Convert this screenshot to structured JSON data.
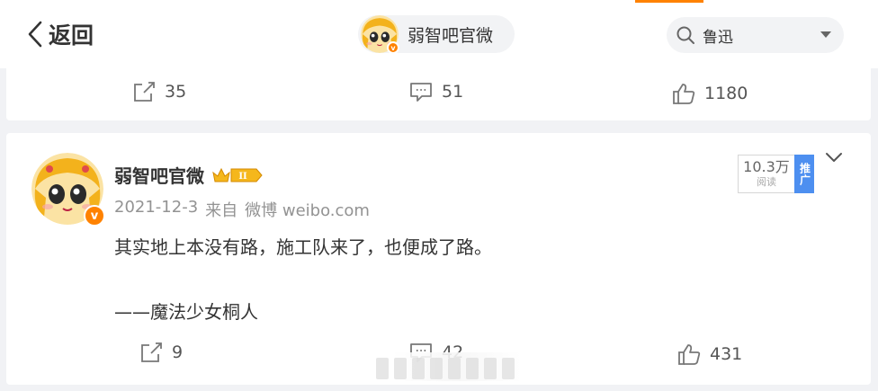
{
  "header": {
    "back_label": "返回",
    "user_name": "弱智吧官微",
    "search_value": "鲁迅"
  },
  "prev_post": {
    "reposts": "35",
    "comments": "51",
    "likes": "1180"
  },
  "post": {
    "author": "弱智吧官微",
    "level_badge": "II",
    "date": "2021-12-3",
    "source_prefix": "来自",
    "source": "微博 weibo.com",
    "text_line1": "其实地上本没有路，施工队来了，也便成了路。",
    "text_line2": "——魔法少女桐人",
    "reads_count": "10.3万",
    "reads_label": "阅读",
    "promo_label": "推广",
    "reposts": "9",
    "comments": "42",
    "likes": "431"
  },
  "colors": {
    "accent": "#ff8200",
    "promo": "#4d8ff0"
  },
  "icons": [
    "back-chevron-icon",
    "search-icon",
    "dropdown-arrow-icon",
    "repost-icon",
    "comment-icon",
    "like-icon",
    "vip-crown-icon",
    "expand-chevron-icon"
  ]
}
